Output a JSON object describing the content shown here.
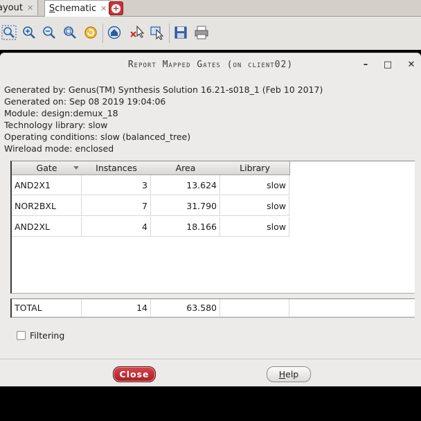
{
  "tabs": [
    {
      "label": "Layout",
      "display": "ayout",
      "close": "✕"
    },
    {
      "label": "Schematic",
      "close": "✕"
    }
  ],
  "add_tab_glyph": "+",
  "toolbar": {
    "icons": [
      "zoom-fit-icon",
      "zoom-in-icon",
      "zoom-out-icon",
      "zoom-area-icon",
      "refresh-icon",
      "home-icon",
      "select-delete-icon",
      "select-move-icon",
      "save-icon",
      "print-icon"
    ]
  },
  "dialog": {
    "title": "Report Mapped Gates (on client02)",
    "window_buttons": {
      "minimize": "–",
      "maximize": "□",
      "close": "✕"
    },
    "info": {
      "generated_by": "Generated by: Genus(TM) Synthesis Solution 16.21-s018_1 (Feb 10 2017)",
      "generated_on": "Generated on: Sep 08 2019 19:04:06",
      "module": "Module: design:demux_18",
      "tech_library": "Technology library: slow",
      "operating_conditions": "Operating conditions: slow (balanced_tree)",
      "wireload_mode": "Wireload mode: enclosed"
    },
    "table": {
      "columns": [
        "Gate",
        "Instances",
        "Area",
        "Library"
      ],
      "rows": [
        {
          "gate": "AND2X1",
          "instances": "3",
          "area": "13.624",
          "library": "slow"
        },
        {
          "gate": "NOR2BXL",
          "instances": "7",
          "area": "31.790",
          "library": "slow"
        },
        {
          "gate": "AND2XL",
          "instances": "4",
          "area": "18.166",
          "library": "slow"
        }
      ],
      "total": {
        "label": "TOTAL",
        "instances": "14",
        "area": "63.580",
        "library": ""
      }
    },
    "filtering_label": "Filtering",
    "close_label": "Close",
    "help_label": "Help",
    "help_label_rest": "elp",
    "help_label_first": "H"
  },
  "colors": {
    "accent_close": "#c8343a",
    "dialog_bg": "#ecebe9"
  }
}
